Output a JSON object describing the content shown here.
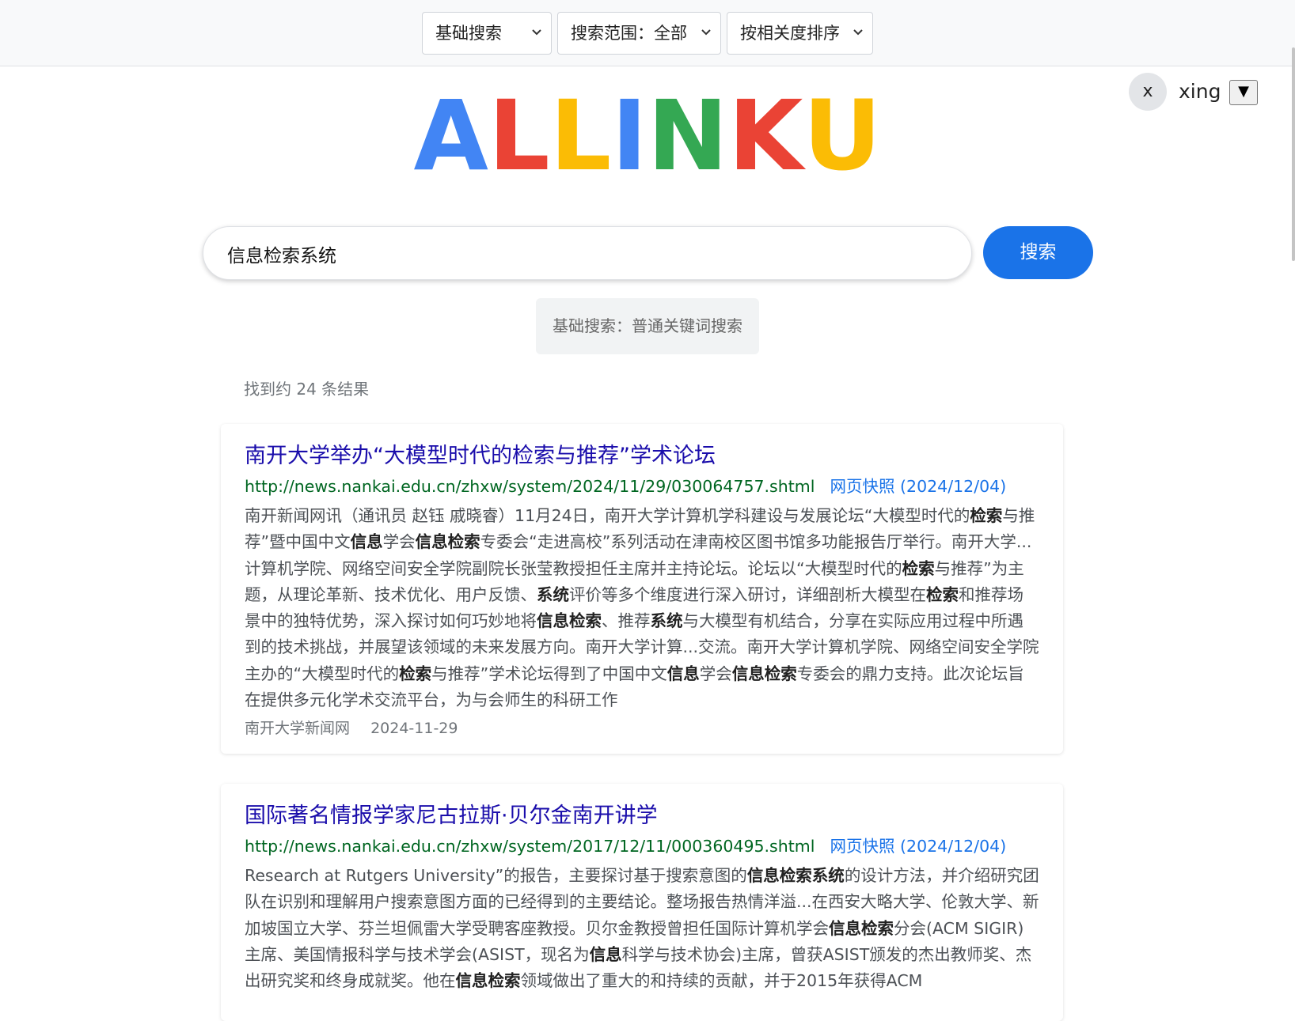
{
  "filters": {
    "search_type": "基础搜索",
    "scope": "搜索范围：全部",
    "sort": "按相关度排序"
  },
  "user": {
    "avatar_letter": "x",
    "name": "xing",
    "dropdown_glyph": "▼"
  },
  "logo": {
    "letters": [
      {
        "char": "A",
        "color": "#4285f4"
      },
      {
        "char": "L",
        "color": "#ea4335"
      },
      {
        "char": "L",
        "color": "#fbbc05"
      },
      {
        "char": "I",
        "color": "#4285f4"
      },
      {
        "char": "N",
        "color": "#34a853"
      },
      {
        "char": "K",
        "color": "#ea4335"
      },
      {
        "char": "U",
        "color": "#fbbc05"
      }
    ]
  },
  "search": {
    "query": "信息检索系统",
    "button_label": "搜索"
  },
  "mode_hint": "基础搜索：普通关键词搜索",
  "result_count": "找到约 24 条结果",
  "results": [
    {
      "title": "南开大学举办“大模型时代的检索与推荐”学术论坛",
      "url": "http://news.nankai.edu.cn/zhxw/system/2024/11/29/030064757.shtml",
      "snapshot": "网页快照 (2024/12/04)",
      "snippet": [
        {
          "t": "南开新闻网讯（通讯员 赵钰 戚晓睿）11月24日，南开大学计算机学科建设与发展论坛“大模型时代的",
          "b": false
        },
        {
          "t": "检索",
          "b": true
        },
        {
          "t": "与推荐”暨中国中文",
          "b": false
        },
        {
          "t": "信息",
          "b": true
        },
        {
          "t": "学会",
          "b": false
        },
        {
          "t": "信息检索",
          "b": true
        },
        {
          "t": "专委会“走进高校”系列活动在津南校区图书馆多功能报告厅举行。南开大学...计算机学院、网络空间安全学院副院长张莹教授担任主席并主持论坛。论坛以“大模型时代的",
          "b": false
        },
        {
          "t": "检索",
          "b": true
        },
        {
          "t": "与推荐”为主题，从理论革新、技术优化、用户反馈、",
          "b": false
        },
        {
          "t": "系统",
          "b": true
        },
        {
          "t": "评价等多个维度进行深入研讨，详细剖析大模型在",
          "b": false
        },
        {
          "t": "检索",
          "b": true
        },
        {
          "t": "和推荐场景中的独特优势，深入探讨如何巧妙地将",
          "b": false
        },
        {
          "t": "信息检索",
          "b": true
        },
        {
          "t": "、推荐",
          "b": false
        },
        {
          "t": "系统",
          "b": true
        },
        {
          "t": "与大模型有机结合，分享在实际应用过程中所遇到的技术挑战，并展望该领域的未来发展方向。南开大学计算...交流。南开大学计算机学院、网络空间安全学院主办的“大模型时代的",
          "b": false
        },
        {
          "t": "检索",
          "b": true
        },
        {
          "t": "与推荐”学术论坛得到了中国中文",
          "b": false
        },
        {
          "t": "信息",
          "b": true
        },
        {
          "t": "学会",
          "b": false
        },
        {
          "t": "信息检索",
          "b": true
        },
        {
          "t": "专委会的鼎力支持。此次论坛旨在提供多元化学术交流平台，为与会师生的科研工作",
          "b": false
        }
      ],
      "source": "南开大学新闻网",
      "date": "2024-11-29"
    },
    {
      "title": "国际著名情报学家尼古拉斯·贝尔金南开讲学",
      "url": "http://news.nankai.edu.cn/zhxw/system/2017/12/11/000360495.shtml",
      "snapshot": "网页快照 (2024/12/04)",
      "snippet": [
        {
          "t": "Research at Rutgers University”的报告，主要探讨基于搜索意图的",
          "b": false
        },
        {
          "t": "信息检索系统",
          "b": true
        },
        {
          "t": "的设计方法，并介绍研究团队在识别和理解用户搜索意图方面的已经得到的主要结论。整场报告热情洋溢...在西安大略大学、伦敦大学、新加坡国立大学、芬兰坦佩雷大学受聘客座教授。贝尔金教授曾担任国际计算机学会",
          "b": false
        },
        {
          "t": "信息检索",
          "b": true
        },
        {
          "t": "分会(ACM SIGIR)主席、美国情报科学与技术学会(ASIST，现名为",
          "b": false
        },
        {
          "t": "信息",
          "b": true
        },
        {
          "t": "科学与技术协会)主席，曾获ASIST颁发的杰出教师奖、杰出研究奖和终身成就奖。他在",
          "b": false
        },
        {
          "t": "信息检索",
          "b": true
        },
        {
          "t": "领域做出了重大的和持续的贡献，并于2015年获得ACM",
          "b": false
        }
      ],
      "source": "",
      "date": ""
    }
  ]
}
